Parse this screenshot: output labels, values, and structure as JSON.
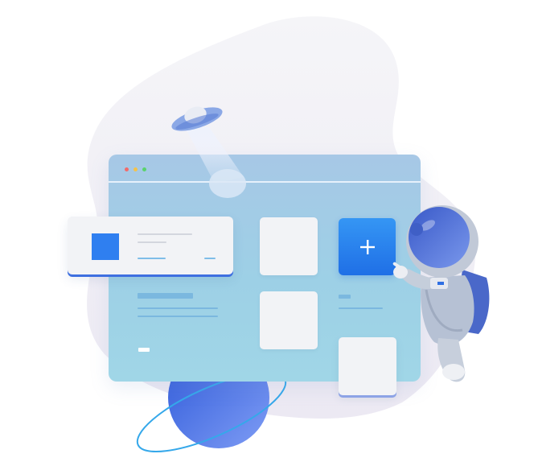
{
  "illustration": {
    "description_icons": [
      "ufo-icon",
      "planet-icon",
      "astronaut-icon",
      "plus-icon"
    ]
  },
  "colors": {
    "browser_top": "#a7c8e6",
    "browser_bottom": "#a0d6e7",
    "accent_blue": "#2f7ff0",
    "tile_bg": "#f2f3f6",
    "dot_red": "#f26a6a",
    "dot_yellow": "#f4c24a",
    "dot_green": "#5ad36c"
  },
  "plus_tile": {
    "symbol": "+"
  }
}
